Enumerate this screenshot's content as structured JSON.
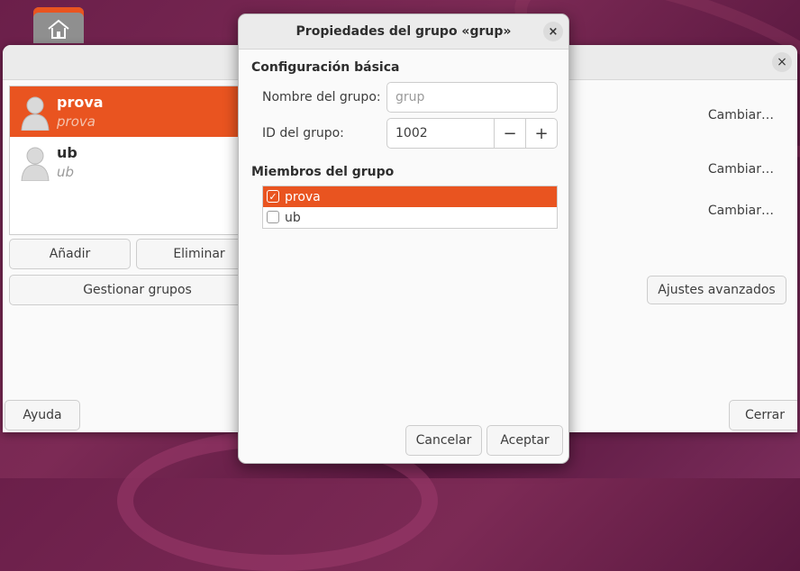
{
  "main_window": {
    "users": [
      {
        "name": "prova",
        "login": "prova",
        "selected": true
      },
      {
        "name": "ub",
        "login": "ub",
        "selected": false
      }
    ],
    "add_label": "Añadir",
    "remove_label": "Eliminar",
    "manage_groups_label": "Gestionar grupos",
    "change_labels": [
      "Cambiar…",
      "Cambiar…",
      "Cambiar…"
    ],
    "advanced_label": "Ajustes avanzados",
    "help_label": "Ayuda",
    "close_label": "Cerrar",
    "close_icon": "×"
  },
  "dialog": {
    "title": "Propiedades del grupo «grup»",
    "close_icon": "×",
    "basic_section": "Configuración básica",
    "group_name_label": "Nombre del grupo:",
    "group_name_placeholder": "grup",
    "group_id_label": "ID del grupo:",
    "group_id_value": "1002",
    "minus": "−",
    "plus": "+",
    "members_section": "Miembros del grupo",
    "members": [
      {
        "name": "prova",
        "checked": true
      },
      {
        "name": "ub",
        "checked": false
      }
    ],
    "cancel_label": "Cancelar",
    "accept_label": "Aceptar"
  },
  "colors": {
    "accent": "#e95420"
  }
}
